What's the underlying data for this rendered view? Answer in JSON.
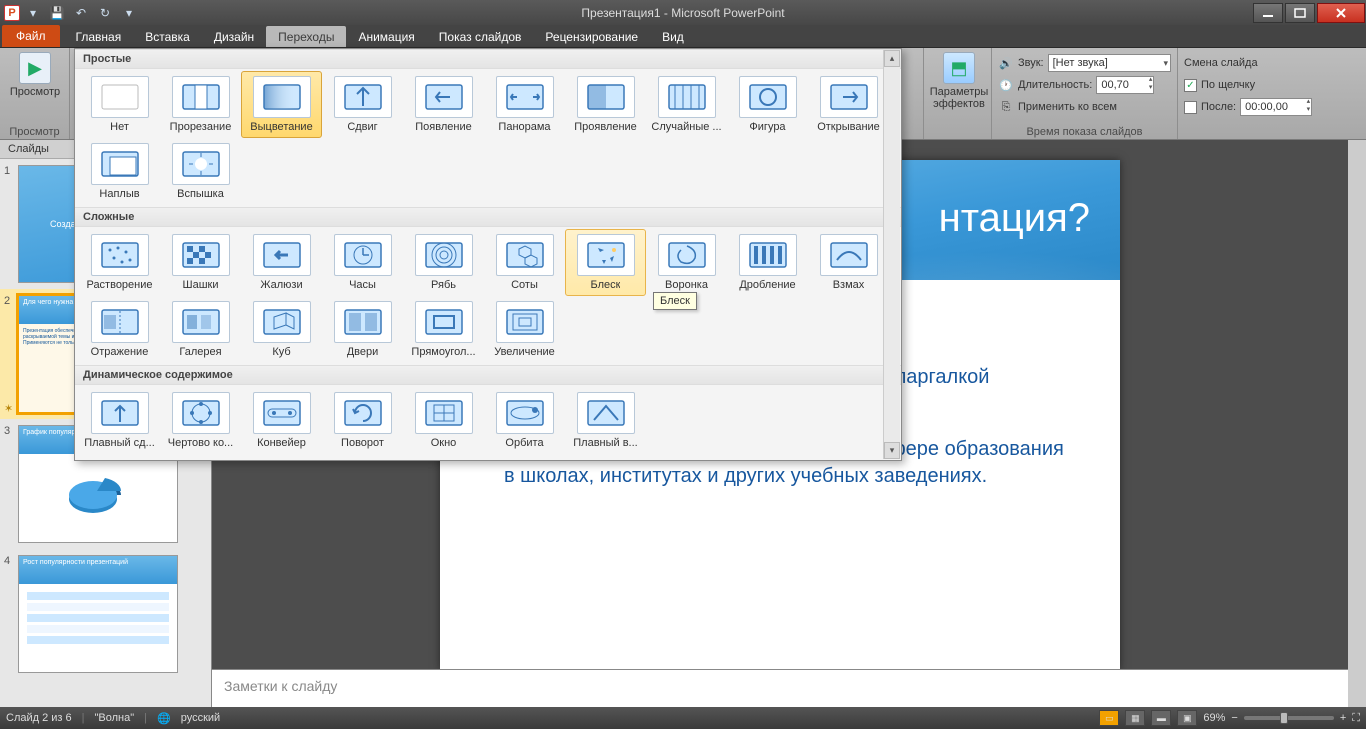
{
  "app": {
    "title": "Презентация1 - Microsoft PowerPoint"
  },
  "qat": {
    "save": "💾",
    "undo": "↶",
    "redo": "↷",
    "repeat": "↻"
  },
  "tabs": {
    "file": "Файл",
    "home": "Главная",
    "insert": "Вставка",
    "design": "Дизайн",
    "transitions": "Переходы",
    "animations": "Анимация",
    "slideshow": "Показ слайдов",
    "review": "Рецензирование",
    "view": "Вид"
  },
  "ribbon": {
    "preview_btn": "Просмотр",
    "preview_grp": "Просмотр",
    "effect_options": "Параметры эффектов",
    "timing_grp": "Время показа слайдов",
    "sound_lbl": "Звук:",
    "sound_val": "[Нет звука]",
    "duration_lbl": "Длительность:",
    "duration_val": "00,70",
    "apply_all": "Применить ко всем",
    "advance_grp": "Смена слайда",
    "on_click": "По щелчку",
    "after_lbl": "После:",
    "after_val": "00:00,00"
  },
  "gallery": {
    "sec_simple": "Простые",
    "sec_complex": "Сложные",
    "sec_dynamic": "Динамическое содержимое",
    "tooltip": "Блеск",
    "simple": [
      {
        "k": "none",
        "l": "Нет"
      },
      {
        "k": "cut",
        "l": "Прорезание"
      },
      {
        "k": "fade",
        "l": "Выцветание"
      },
      {
        "k": "push",
        "l": "Сдвиг"
      },
      {
        "k": "wipe",
        "l": "Появление"
      },
      {
        "k": "split",
        "l": "Панорама"
      },
      {
        "k": "reveal",
        "l": "Проявление"
      },
      {
        "k": "random",
        "l": "Случайные ..."
      },
      {
        "k": "shape",
        "l": "Фигура"
      },
      {
        "k": "uncover",
        "l": "Открывание"
      },
      {
        "k": "cover",
        "l": "Наплыв"
      },
      {
        "k": "flash",
        "l": "Вспышка"
      }
    ],
    "complex": [
      {
        "k": "dissolve",
        "l": "Растворение"
      },
      {
        "k": "checker",
        "l": "Шашки"
      },
      {
        "k": "blinds",
        "l": "Жалюзи"
      },
      {
        "k": "clock",
        "l": "Часы"
      },
      {
        "k": "ripple",
        "l": "Рябь"
      },
      {
        "k": "honeycomb",
        "l": "Соты"
      },
      {
        "k": "glitter",
        "l": "Блеск"
      },
      {
        "k": "vortex",
        "l": "Воронка"
      },
      {
        "k": "shred",
        "l": "Дробление"
      },
      {
        "k": "switch",
        "l": "Взмах"
      },
      {
        "k": "flip",
        "l": "Отражение"
      },
      {
        "k": "gallery2",
        "l": "Галерея"
      },
      {
        "k": "cube",
        "l": "Куб"
      },
      {
        "k": "doors",
        "l": "Двери"
      },
      {
        "k": "box",
        "l": "Прямоугол..."
      },
      {
        "k": "zoom",
        "l": "Увеличение"
      }
    ],
    "dynamic": [
      {
        "k": "pan",
        "l": "Плавный сд..."
      },
      {
        "k": "ferris",
        "l": "Чертово ко..."
      },
      {
        "k": "conveyor",
        "l": "Конвейер"
      },
      {
        "k": "rotate",
        "l": "Поворот"
      },
      {
        "k": "window",
        "l": "Окно"
      },
      {
        "k": "orbit",
        "l": "Орбита"
      },
      {
        "k": "flythrough",
        "l": "Плавный в..."
      }
    ]
  },
  "panes": {
    "slides_tab": "Слайды"
  },
  "thumbs": {
    "t1": "Создание презентации",
    "t2": "Для чего нужна презентация?",
    "t3": "График популярности презентаций",
    "t4": "Рост популярности презентаций"
  },
  "slide": {
    "title_suffix": "нтация?",
    "bullet1_tail": "диторией раскрываемой темы и служит шпаргалкой докладчику.",
    "bullet2": "Применяются не только в бизнесе, но и сфере образования в школах, институтах и других учебных заведениях."
  },
  "notes": {
    "placeholder": "Заметки к слайду"
  },
  "status": {
    "slide_info": "Слайд 2 из 6",
    "theme": "\"Волна\"",
    "lang": "русский",
    "zoom": "69%"
  }
}
